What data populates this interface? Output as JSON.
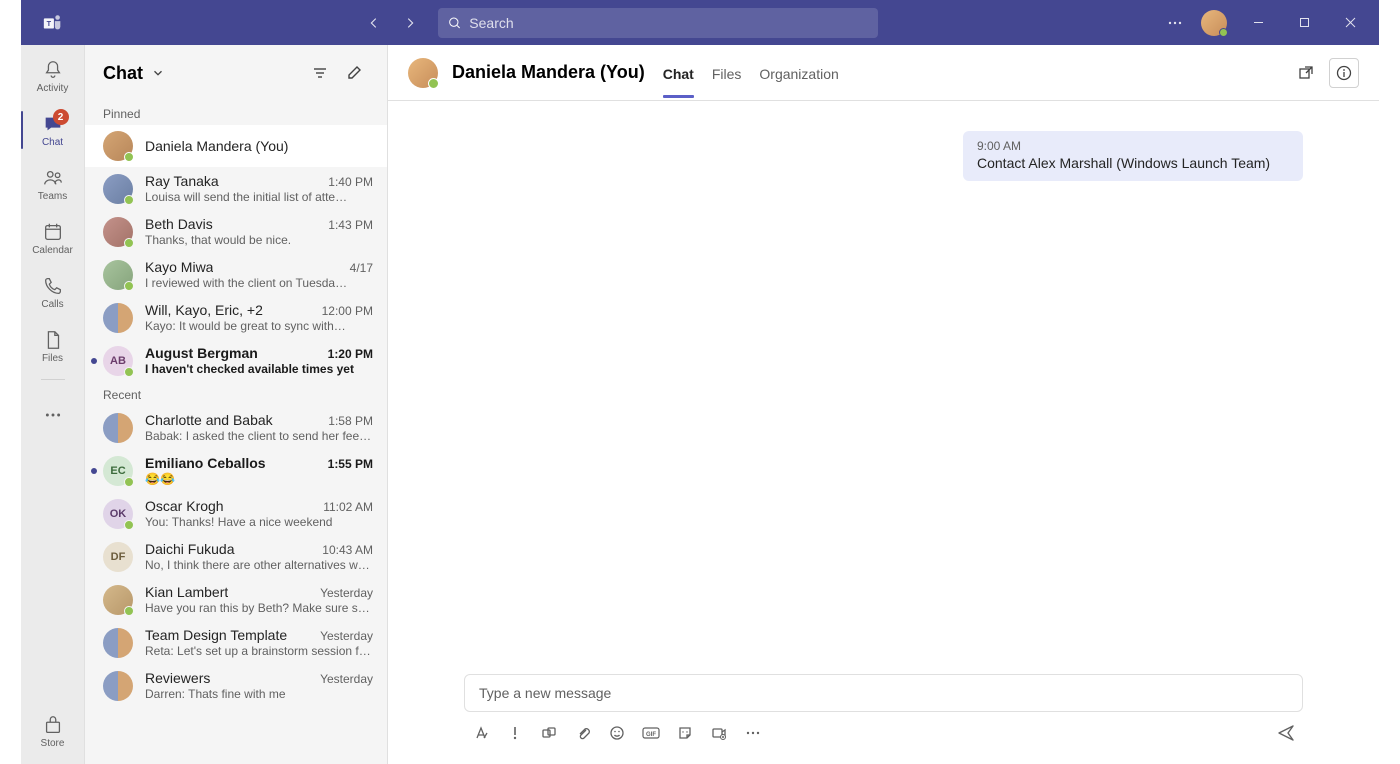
{
  "titlebar": {
    "search_placeholder": "Search",
    "logo_alt": "Teams"
  },
  "rail": {
    "items": [
      {
        "label": "Activity"
      },
      {
        "label": "Chat",
        "badge": "2"
      },
      {
        "label": "Teams"
      },
      {
        "label": "Calendar"
      },
      {
        "label": "Calls"
      },
      {
        "label": "Files"
      }
    ],
    "store_label": "Store"
  },
  "chatlist": {
    "title": "Chat",
    "sections": {
      "pinned": "Pinned",
      "recent": "Recent"
    },
    "pinned": [
      {
        "name": "Daniela Mandera (You)",
        "time": "",
        "preview": "",
        "avatar": "av-img",
        "presence": true,
        "selected": true
      },
      {
        "name": "Ray Tanaka",
        "time": "1:40 PM",
        "preview": "Louisa will send the initial list of atte…",
        "avatar": "av-img2",
        "presence": true
      },
      {
        "name": "Beth Davis",
        "time": "1:43 PM",
        "preview": "Thanks, that would be nice.",
        "avatar": "av-img3",
        "presence": true
      },
      {
        "name": "Kayo Miwa",
        "time": "4/17",
        "preview": "I reviewed with the client on Tuesda…",
        "avatar": "av-img4",
        "presence": true
      },
      {
        "name": "Will, Kayo, Eric, +2",
        "time": "12:00 PM",
        "preview": "Kayo: It would be great to sync with…",
        "avatar": "av-group",
        "presence": false
      },
      {
        "name": "August Bergman",
        "time": "1:20 PM",
        "preview": "I haven't checked available times yet",
        "avatar": "av-ab",
        "initials": "AB",
        "presence": true,
        "unread": true
      }
    ],
    "recent": [
      {
        "name": "Charlotte and Babak",
        "time": "1:58 PM",
        "preview": "Babak: I asked the client to send her feed…",
        "avatar": "av-group",
        "presence": false
      },
      {
        "name": "Emiliano Ceballos",
        "time": "1:55 PM",
        "preview": "😂😂",
        "avatar": "av-ec",
        "initials": "EC",
        "presence": true,
        "unread": true
      },
      {
        "name": "Oscar Krogh",
        "time": "11:02 AM",
        "preview": "You: Thanks! Have a nice weekend",
        "avatar": "av-ok",
        "initials": "OK",
        "presence": true
      },
      {
        "name": "Daichi Fukuda",
        "time": "10:43 AM",
        "preview": "No, I think there are other alternatives we c…",
        "avatar": "av-df",
        "initials": "DF",
        "presence": false
      },
      {
        "name": "Kian Lambert",
        "time": "Yesterday",
        "preview": "Have you ran this by Beth? Make sure she is…",
        "avatar": "av-img5",
        "presence": true
      },
      {
        "name": "Team Design Template",
        "time": "Yesterday",
        "preview": "Reta: Let's set up a brainstorm session for…",
        "avatar": "av-group",
        "presence": false
      },
      {
        "name": "Reviewers",
        "time": "Yesterday",
        "preview": "Darren: Thats fine with me",
        "avatar": "av-group",
        "presence": false
      }
    ]
  },
  "chatview": {
    "title": "Daniela Mandera (You)",
    "tabs": [
      "Chat",
      "Files",
      "Organization"
    ],
    "message_time": "9:00 AM",
    "message_text": "Contact Alex Marshall (Windows Launch Team)",
    "composer_placeholder": "Type a new message"
  }
}
